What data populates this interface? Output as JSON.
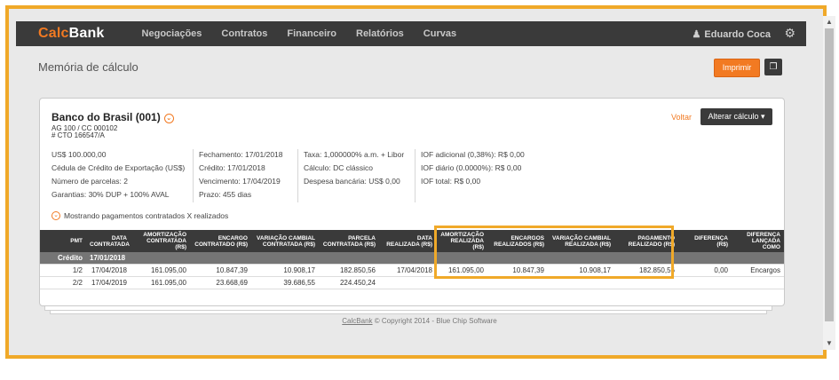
{
  "app": {
    "logo_calc": "Calc",
    "logo_bank": "Bank"
  },
  "nav": [
    "Negociações",
    "Contratos",
    "Financeiro",
    "Relatórios",
    "Curvas"
  ],
  "user": {
    "name": "Eduardo Coca",
    "icon": "user-icon"
  },
  "settings_icon": "gear-icon",
  "page": {
    "title": "Memória de cálculo",
    "print_label": "Imprimir",
    "copy_icon": "copy-icon"
  },
  "card": {
    "bank_name": "Banco do Brasil (001)",
    "ag": "AG 100 / CC 000102",
    "contract": "# CTO 166547/A",
    "voltar": "Voltar",
    "alterar": "Alterar cálculo",
    "info": {
      "col1": [
        "US$ 100.000,00",
        "Cédula de Crédito de Exportação (US$)",
        "Número de parcelas: 2",
        "Garantias: 30% DUP + 100% AVAL"
      ],
      "col2": [
        "Fechamento: 17/01/2018",
        "Crédito: 17/01/2018",
        "Vencimento: 17/04/2019",
        "Prazo: 455 dias"
      ],
      "col3": [
        "Taxa: 1,000000% a.m. + Libor",
        "Cálculo: DC clássico",
        "Despesa bancária: US$ 0,00"
      ],
      "col4": [
        "IOF adicional (0,38%): R$ 0,00",
        "IOF diário (0.0000%): R$ 0,00",
        "IOF total: R$ 0,00"
      ]
    },
    "toggle": "Mostrando pagamentos contratados X realizados"
  },
  "table": {
    "headers": [
      [
        "PMT"
      ],
      [
        "DATA",
        "CONTRATADA"
      ],
      [
        "AMORTIZAÇÃO",
        "CONTRATADA (R$)"
      ],
      [
        "ENCARGO",
        "CONTRATADO (R$)"
      ],
      [
        "VARIAÇÃO CAMBIAL",
        "CONTRATADA (R$)"
      ],
      [
        "PARCELA",
        "CONTRATADA (R$)"
      ],
      [
        "DATA",
        "REALIZADA (R$)"
      ],
      [
        "AMORTIZAÇÃO",
        "REALIZADA (R$)"
      ],
      [
        "ENCARGOS",
        "REALIZADOS (R$)"
      ],
      [
        "VARIAÇÃO CAMBIAL",
        "REALIZADA (R$)"
      ],
      [
        "PAGAMENTO",
        "REALIZADO (R$)"
      ],
      [
        "DIFERENÇA",
        "(R$)"
      ],
      [
        "DIFERENÇA",
        "LANÇADA COMO"
      ]
    ],
    "group": {
      "label": "Crédito",
      "date": "17/01/2018"
    },
    "rows": [
      [
        "1/2",
        "17/04/2018",
        "161.095,00",
        "10.847,39",
        "10.908,17",
        "182.850,56",
        "17/04/2018",
        "161.095,00",
        "10.847,39",
        "10.908,17",
        "182.850,56",
        "0,00",
        "Encargos"
      ],
      [
        "2/2",
        "17/04/2019",
        "161.095,00",
        "23.668,69",
        "39.686,55",
        "224.450,24",
        "",
        "",
        "",
        "",
        "",
        "",
        ""
      ]
    ]
  },
  "footer": {
    "brand": "CalcBank",
    "text": " © Copyright 2014 - Blue Chip Software"
  }
}
